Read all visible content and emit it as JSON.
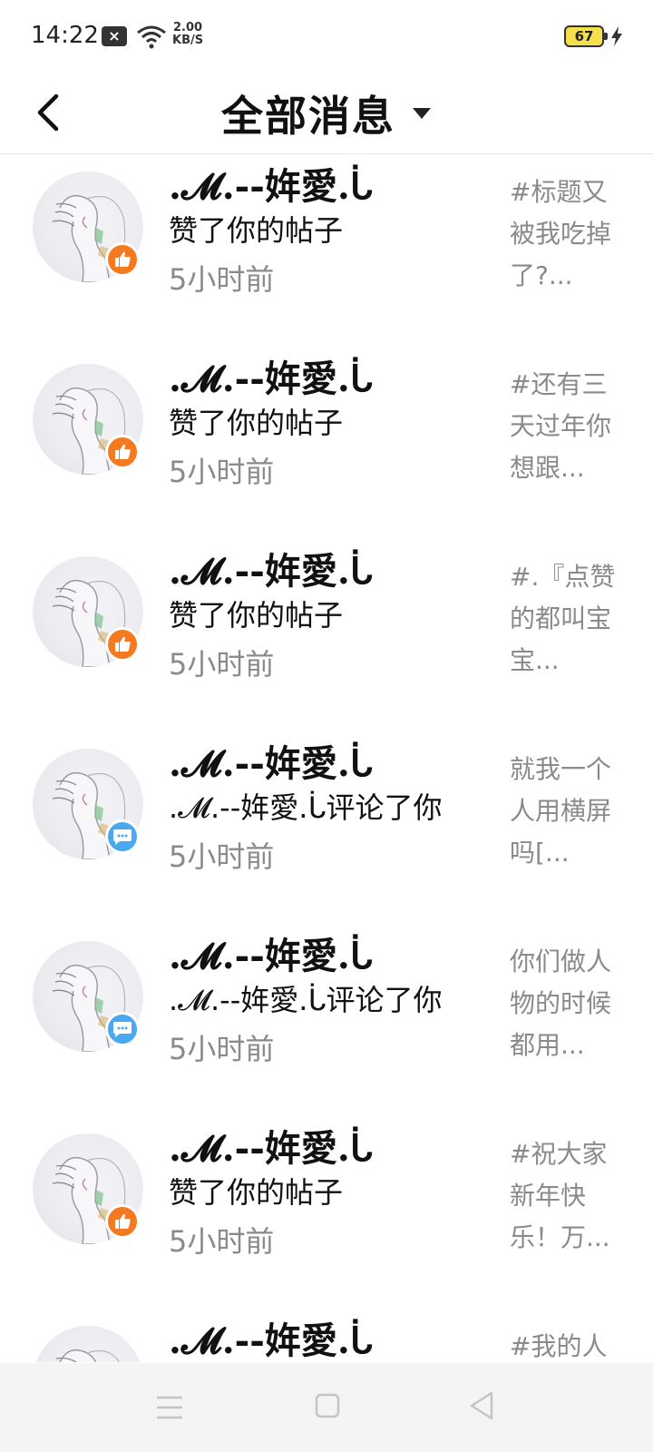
{
  "status_bar": {
    "time": "14:22",
    "net_speed_value": "2.00",
    "net_speed_unit": "KB/S",
    "battery": "67"
  },
  "header": {
    "title": "全部消息"
  },
  "messages": [
    {
      "name": ".𝓜.--姩愛.ᒑ",
      "action": "赞了你的帖子",
      "time": "5小时前",
      "preview": "#标题又被我吃掉了?...",
      "type": "like"
    },
    {
      "name": ".𝓜.--姩愛.ᒑ",
      "action": "赞了你的帖子",
      "time": "5小时前",
      "preview": "#还有三天过年你想跟...",
      "type": "like"
    },
    {
      "name": ".𝓜.--姩愛.ᒑ",
      "action": "赞了你的帖子",
      "time": "5小时前",
      "preview": "#.『点赞的都叫宝宝...",
      "type": "like"
    },
    {
      "name": ".𝓜.--姩愛.ᒑ",
      "action": ".𝓜.--姩愛.ᒑ评论了你",
      "time": "5小时前",
      "preview": "就我一个人用横屏吗[...",
      "type": "comment"
    },
    {
      "name": ".𝓜.--姩愛.ᒑ",
      "action": ".𝓜.--姩愛.ᒑ评论了你",
      "time": "5小时前",
      "preview": "你们做人物的时候都用...",
      "type": "comment"
    },
    {
      "name": ".𝓜.--姩愛.ᒑ",
      "action": "赞了你的帖子",
      "time": "5小时前",
      "preview": "#祝大家新年快乐！万...",
      "type": "like"
    },
    {
      "name": ".𝓜.--姩愛.ᒑ",
      "action": "",
      "time": "",
      "preview": "#我的人",
      "type": "like"
    }
  ],
  "icons": {
    "like_badge": "thumbs-up-icon",
    "comment_badge": "chat-bubble-icon",
    "back": "back-arrow-icon",
    "dropdown": "caret-down-icon"
  },
  "colors": {
    "like_badge": "#f57a1f",
    "comment_badge": "#4aa8ef",
    "secondary_text": "#8a8a8a"
  }
}
